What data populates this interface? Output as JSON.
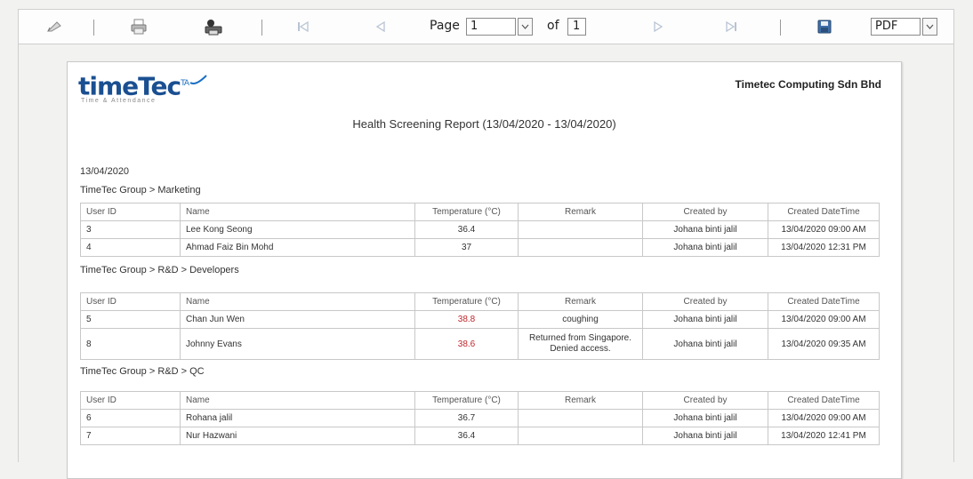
{
  "toolbar": {
    "page_label": "Page",
    "page_value": "1",
    "of_label": "of",
    "total_pages": "1",
    "export_format": "PDF",
    "icons": [
      "edit-icon",
      "print-icon",
      "print-setup-icon",
      "first-page-icon",
      "prev-page-icon",
      "next-page-icon",
      "last-page-icon",
      "save-icon"
    ]
  },
  "report": {
    "logo_main": "timeTec",
    "logo_sup": "TA",
    "logo_sub": "Time & Attendance",
    "company": "Timetec Computing Sdn Bhd",
    "title": "Health Screening Report (13/04/2020 - 13/04/2020)",
    "date": "13/04/2020",
    "columns": [
      "User ID",
      "Name",
      "Temperature (°C)",
      "Remark",
      "Created by",
      "Created DateTime"
    ],
    "groups": [
      {
        "label": "TimeTec Group > Marketing",
        "rows": [
          {
            "id": "3",
            "name": "Lee Kong Seong",
            "temp": "36.4",
            "remark": "",
            "created_by": "Johana binti jalil",
            "created_at": "13/04/2020 09:00 AM"
          },
          {
            "id": "4",
            "name": "Ahmad Faiz Bin Mohd",
            "temp": "37",
            "remark": "",
            "created_by": "Johana binti jalil",
            "created_at": "13/04/2020 12:31 PM"
          }
        ]
      },
      {
        "label": "TimeTec Group > R&D > Developers",
        "rows": [
          {
            "id": "5",
            "name": "Chan Jun Wen",
            "temp": "38.8",
            "remark": "coughing",
            "created_by": "Johana binti jalil",
            "created_at": "13/04/2020 09:00 AM"
          },
          {
            "id": "8",
            "name": "Johnny Evans",
            "temp": "38.6",
            "remark": "Returned from Singapore. Denied access.",
            "created_by": "Johana binti jalil",
            "created_at": "13/04/2020 09:35 AM"
          }
        ]
      },
      {
        "label": "TimeTec Group > R&D > QC",
        "rows": [
          {
            "id": "6",
            "name": "Rohana jalil",
            "temp": "36.7",
            "remark": "",
            "created_by": "Johana binti jalil",
            "created_at": "13/04/2020 09:00 AM"
          },
          {
            "id": "7",
            "name": "Nur Hazwani",
            "temp": "36.4",
            "remark": "",
            "created_by": "Johana binti jalil",
            "created_at": "13/04/2020 12:41 PM"
          }
        ]
      }
    ]
  },
  "colors": {
    "high_temp": "#c0262d",
    "logo_blue": "#1a4f91"
  }
}
